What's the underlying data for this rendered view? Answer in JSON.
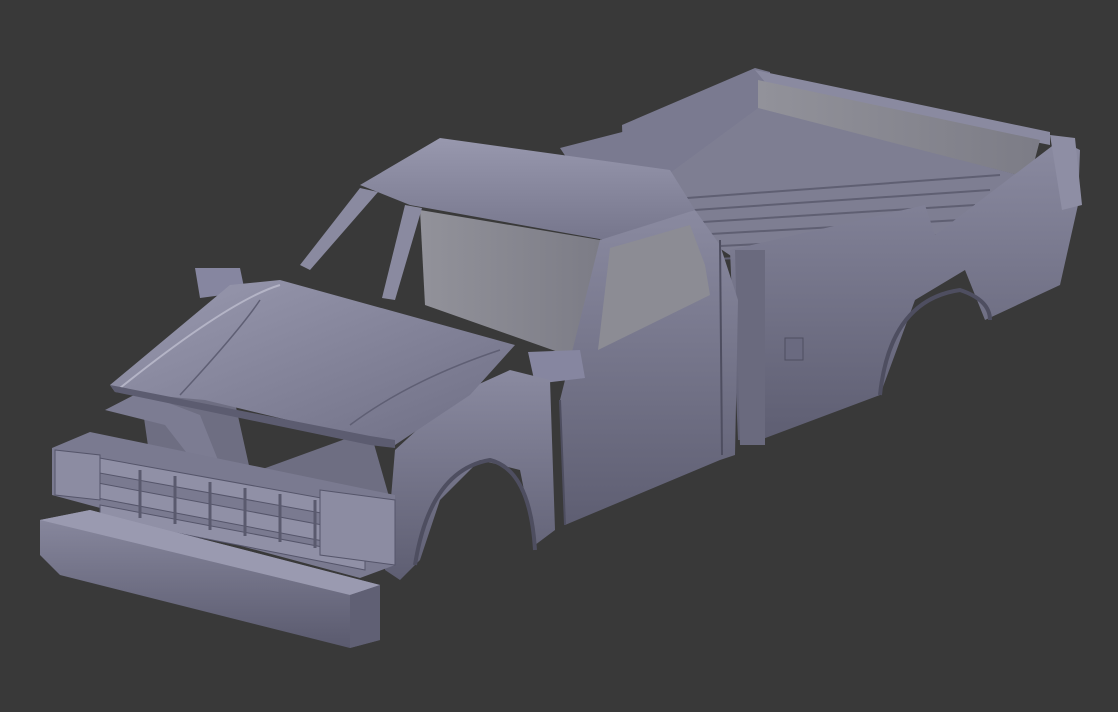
{
  "viewport": {
    "background_color": "#393939",
    "object_base_color": "#7e7e96",
    "object_light_color": "#9a9ab0",
    "object_dark_color": "#595a6d",
    "interior_color": "#8c8c94"
  },
  "model": {
    "icon": "pickup-truck-body-icon"
  }
}
